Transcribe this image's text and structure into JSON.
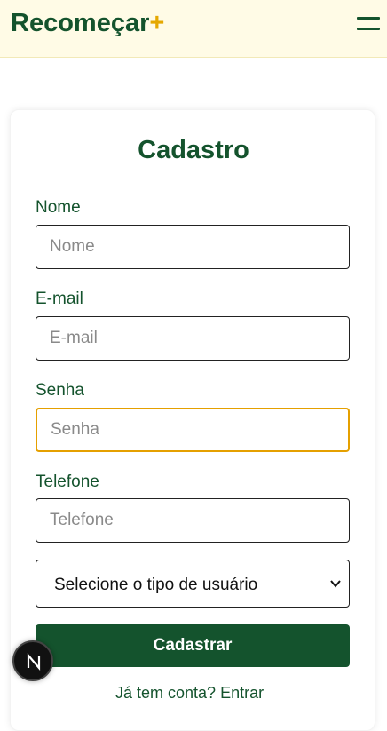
{
  "header": {
    "brand_name": "Recomeçar",
    "brand_plus": "+",
    "menu_icon": "hamburger-icon"
  },
  "form": {
    "title": "Cadastro",
    "name_label": "Nome",
    "name_placeholder": "Nome",
    "email_label": "E-mail",
    "email_placeholder": "E-mail",
    "password_label": "Senha",
    "password_placeholder": "Senha",
    "phone_label": "Telefone",
    "phone_placeholder": "Telefone",
    "user_type_selected": "Selecione o tipo de usuário",
    "submit_label": "Cadastrar",
    "login_prompt": "Já tem conta? Entrar"
  },
  "colors": {
    "brand_green": "#14532d",
    "accent_yellow": "#e5a800",
    "header_bg": "#fffbe6"
  },
  "badge": {
    "icon": "next-logo-icon"
  }
}
